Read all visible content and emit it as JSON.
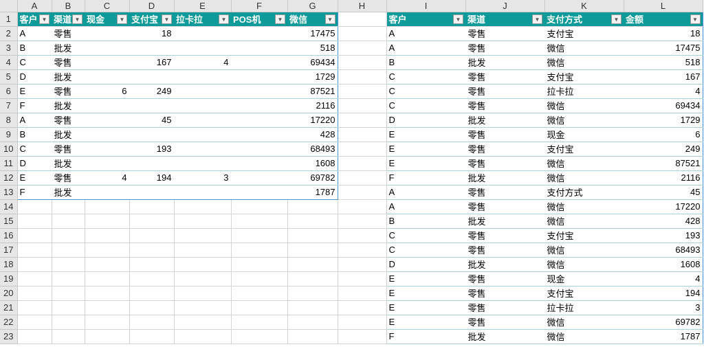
{
  "columns": [
    "A",
    "B",
    "C",
    "D",
    "E",
    "F",
    "G",
    "H",
    "I",
    "J",
    "K",
    "L"
  ],
  "left_table": {
    "headers": [
      "客户",
      "渠道",
      "现金",
      "支付宝",
      "拉卡拉",
      "POS机",
      "微信"
    ],
    "rows": [
      [
        "A",
        "零售",
        "",
        "18",
        "",
        "",
        "17475"
      ],
      [
        "B",
        "批发",
        "",
        "",
        "",
        "",
        "518"
      ],
      [
        "C",
        "零售",
        "",
        "167",
        "4",
        "",
        "69434"
      ],
      [
        "D",
        "批发",
        "",
        "",
        "",
        "",
        "1729"
      ],
      [
        "E",
        "零售",
        "6",
        "249",
        "",
        "",
        "87521"
      ],
      [
        "F",
        "批发",
        "",
        "",
        "",
        "",
        "2116"
      ],
      [
        "A",
        "零售",
        "",
        "45",
        "",
        "",
        "17220"
      ],
      [
        "B",
        "批发",
        "",
        "",
        "",
        "",
        "428"
      ],
      [
        "C",
        "零售",
        "",
        "193",
        "",
        "",
        "68493"
      ],
      [
        "D",
        "批发",
        "",
        "",
        "",
        "",
        "1608"
      ],
      [
        "E",
        "零售",
        "4",
        "194",
        "3",
        "",
        "69782"
      ],
      [
        "F",
        "批发",
        "",
        "",
        "",
        "",
        "1787"
      ]
    ]
  },
  "right_table": {
    "headers": [
      "客户",
      "渠道",
      "支付方式",
      "金额"
    ],
    "rows": [
      [
        "A",
        "零售",
        "支付宝",
        "18"
      ],
      [
        "A",
        "零售",
        "微信",
        "17475"
      ],
      [
        "B",
        "批发",
        "微信",
        "518"
      ],
      [
        "C",
        "零售",
        "支付宝",
        "167"
      ],
      [
        "C",
        "零售",
        "拉卡拉",
        "4"
      ],
      [
        "C",
        "零售",
        "微信",
        "69434"
      ],
      [
        "D",
        "批发",
        "微信",
        "1729"
      ],
      [
        "E",
        "零售",
        "现金",
        "6"
      ],
      [
        "E",
        "零售",
        "支付宝",
        "249"
      ],
      [
        "E",
        "零售",
        "微信",
        "87521"
      ],
      [
        "F",
        "批发",
        "微信",
        "2116"
      ],
      [
        "A",
        "零售",
        "支付方式",
        "45"
      ],
      [
        "A",
        "零售",
        "微信",
        "17220"
      ],
      [
        "B",
        "批发",
        "微信",
        "428"
      ],
      [
        "C",
        "零售",
        "支付宝",
        "193"
      ],
      [
        "C",
        "零售",
        "微信",
        "68493"
      ],
      [
        "D",
        "批发",
        "微信",
        "1608"
      ],
      [
        "E",
        "零售",
        "现金",
        "4"
      ],
      [
        "E",
        "零售",
        "支付宝",
        "194"
      ],
      [
        "E",
        "零售",
        "拉卡拉",
        "3"
      ],
      [
        "E",
        "零售",
        "微信",
        "69782"
      ],
      [
        "F",
        "批发",
        "微信",
        "1787"
      ]
    ]
  },
  "row_count": 23
}
